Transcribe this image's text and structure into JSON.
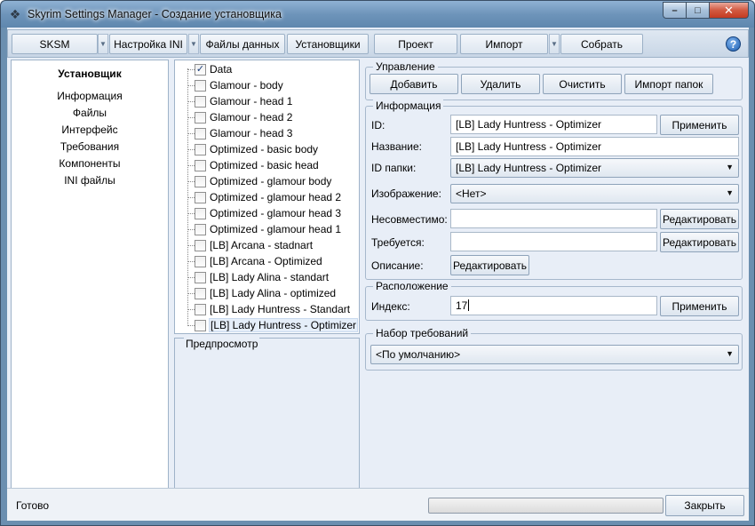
{
  "window": {
    "title": "Skyrim Settings Manager - Создание установщика",
    "minimize_label": "–",
    "maximize_label": "□",
    "close_label": "✕"
  },
  "toolbar": {
    "items": [
      {
        "label": "SKSM"
      },
      {
        "label": "Настройка INI"
      },
      {
        "label": "Файлы данных"
      },
      {
        "label": "Установщики"
      },
      {
        "label": "Проект"
      },
      {
        "label": "Импорт"
      },
      {
        "label": "Собрать"
      }
    ],
    "help_label": "?"
  },
  "sidebar": {
    "title": "Установщик",
    "items": [
      {
        "label": "Информация"
      },
      {
        "label": "Файлы"
      },
      {
        "label": "Интерфейс"
      },
      {
        "label": "Требования"
      },
      {
        "label": "Компоненты"
      },
      {
        "label": "INI файлы"
      }
    ]
  },
  "tree": {
    "items": [
      {
        "label": "Data",
        "checked": true
      },
      {
        "label": "Glamour - body",
        "checked": false
      },
      {
        "label": "Glamour - head 1",
        "checked": false
      },
      {
        "label": "Glamour - head 2",
        "checked": false
      },
      {
        "label": "Glamour - head 3",
        "checked": false
      },
      {
        "label": "Optimized - basic body",
        "checked": false
      },
      {
        "label": "Optimized - basic head",
        "checked": false
      },
      {
        "label": "Optimized - glamour body",
        "checked": false
      },
      {
        "label": "Optimized - glamour head 2",
        "checked": false
      },
      {
        "label": "Optimized - glamour head 3",
        "checked": false
      },
      {
        "label": "Optimized - glamour head 1",
        "checked": false
      },
      {
        "label": "[LB] Arcana - stadnart",
        "checked": false
      },
      {
        "label": "[LB] Arcana - Optimized",
        "checked": false
      },
      {
        "label": "[LB] Lady Alina - standart",
        "checked": false
      },
      {
        "label": "[LB] Lady Alina - optimized",
        "checked": false
      },
      {
        "label": "[LB] Lady Huntress - Standart",
        "checked": false
      },
      {
        "label": "[LB] Lady Huntress - Optimizer",
        "checked": false
      }
    ],
    "check_glyph": "✓"
  },
  "preview": {
    "legend": "Предпросмотр"
  },
  "management": {
    "legend": "Управление",
    "add_label": "Добавить",
    "delete_label": "Удалить",
    "clear_label": "Очистить",
    "import_label": "Импорт папок"
  },
  "info": {
    "legend": "Информация",
    "id_label": "ID:",
    "id_value": "[LB] Lady Huntress - Optimizer",
    "apply_label": "Применить",
    "name_label": "Название:",
    "name_value": "[LB] Lady Huntress - Optimizer",
    "folder_label": "ID папки:",
    "folder_value": "[LB] Lady Huntress - Optimizer",
    "image_label": "Изображение:",
    "image_value": "<Нет>",
    "incompatible_label": "Несовместимо:",
    "incompatible_value": "",
    "required_label": "Требуется:",
    "required_value": "",
    "edit_label": "Редактировать",
    "description_label": "Описание:"
  },
  "location": {
    "legend": "Расположение",
    "index_label": "Индекс:",
    "index_value": "17",
    "apply_label": "Применить"
  },
  "requirements": {
    "legend": "Набор требований",
    "value": "<По умолчанию>"
  },
  "status": {
    "text": "Готово",
    "progress": 0.0,
    "close_label": "Закрыть"
  },
  "colors": {
    "accent": "#1d5fb3",
    "panel": "#e8eef7",
    "border": "#9fb3c9"
  }
}
